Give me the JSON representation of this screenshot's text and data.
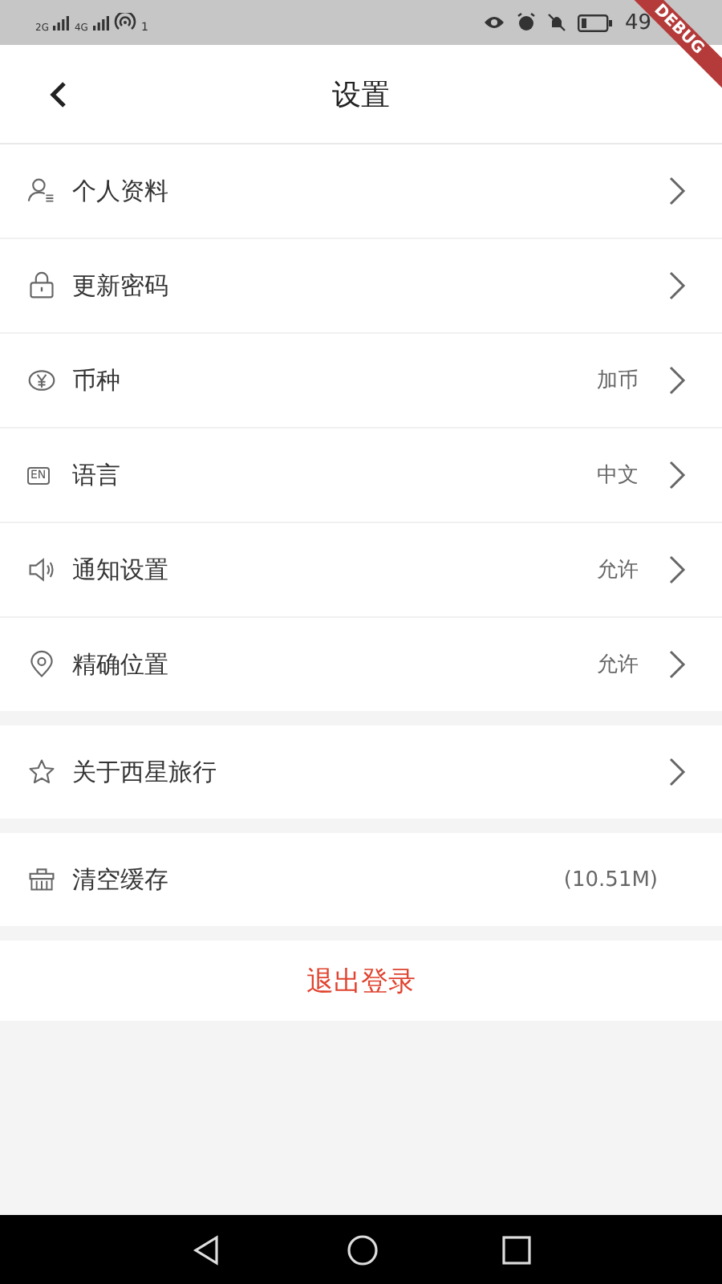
{
  "status_bar": {
    "network_1": "2G",
    "network_2": "4G",
    "hotspot_count": "1",
    "clock": "49"
  },
  "debug_banner": "DEBUG",
  "app_bar": {
    "title": "设置"
  },
  "groups": [
    {
      "items": [
        {
          "label": "个人资料"
        },
        {
          "label": "更新密码"
        },
        {
          "label": "币种",
          "value": "加币"
        },
        {
          "icon_text": "EN",
          "label": "语言",
          "value": "中文"
        },
        {
          "label": "通知设置",
          "value": "允许"
        },
        {
          "label": "精确位置",
          "value": "允许"
        }
      ]
    },
    {
      "items": [
        {
          "label": "关于西星旅行"
        }
      ]
    },
    {
      "items": [
        {
          "label": "清空缓存",
          "value": "(10.51M)",
          "chevron": false
        }
      ]
    }
  ],
  "logout": "退出登录"
}
